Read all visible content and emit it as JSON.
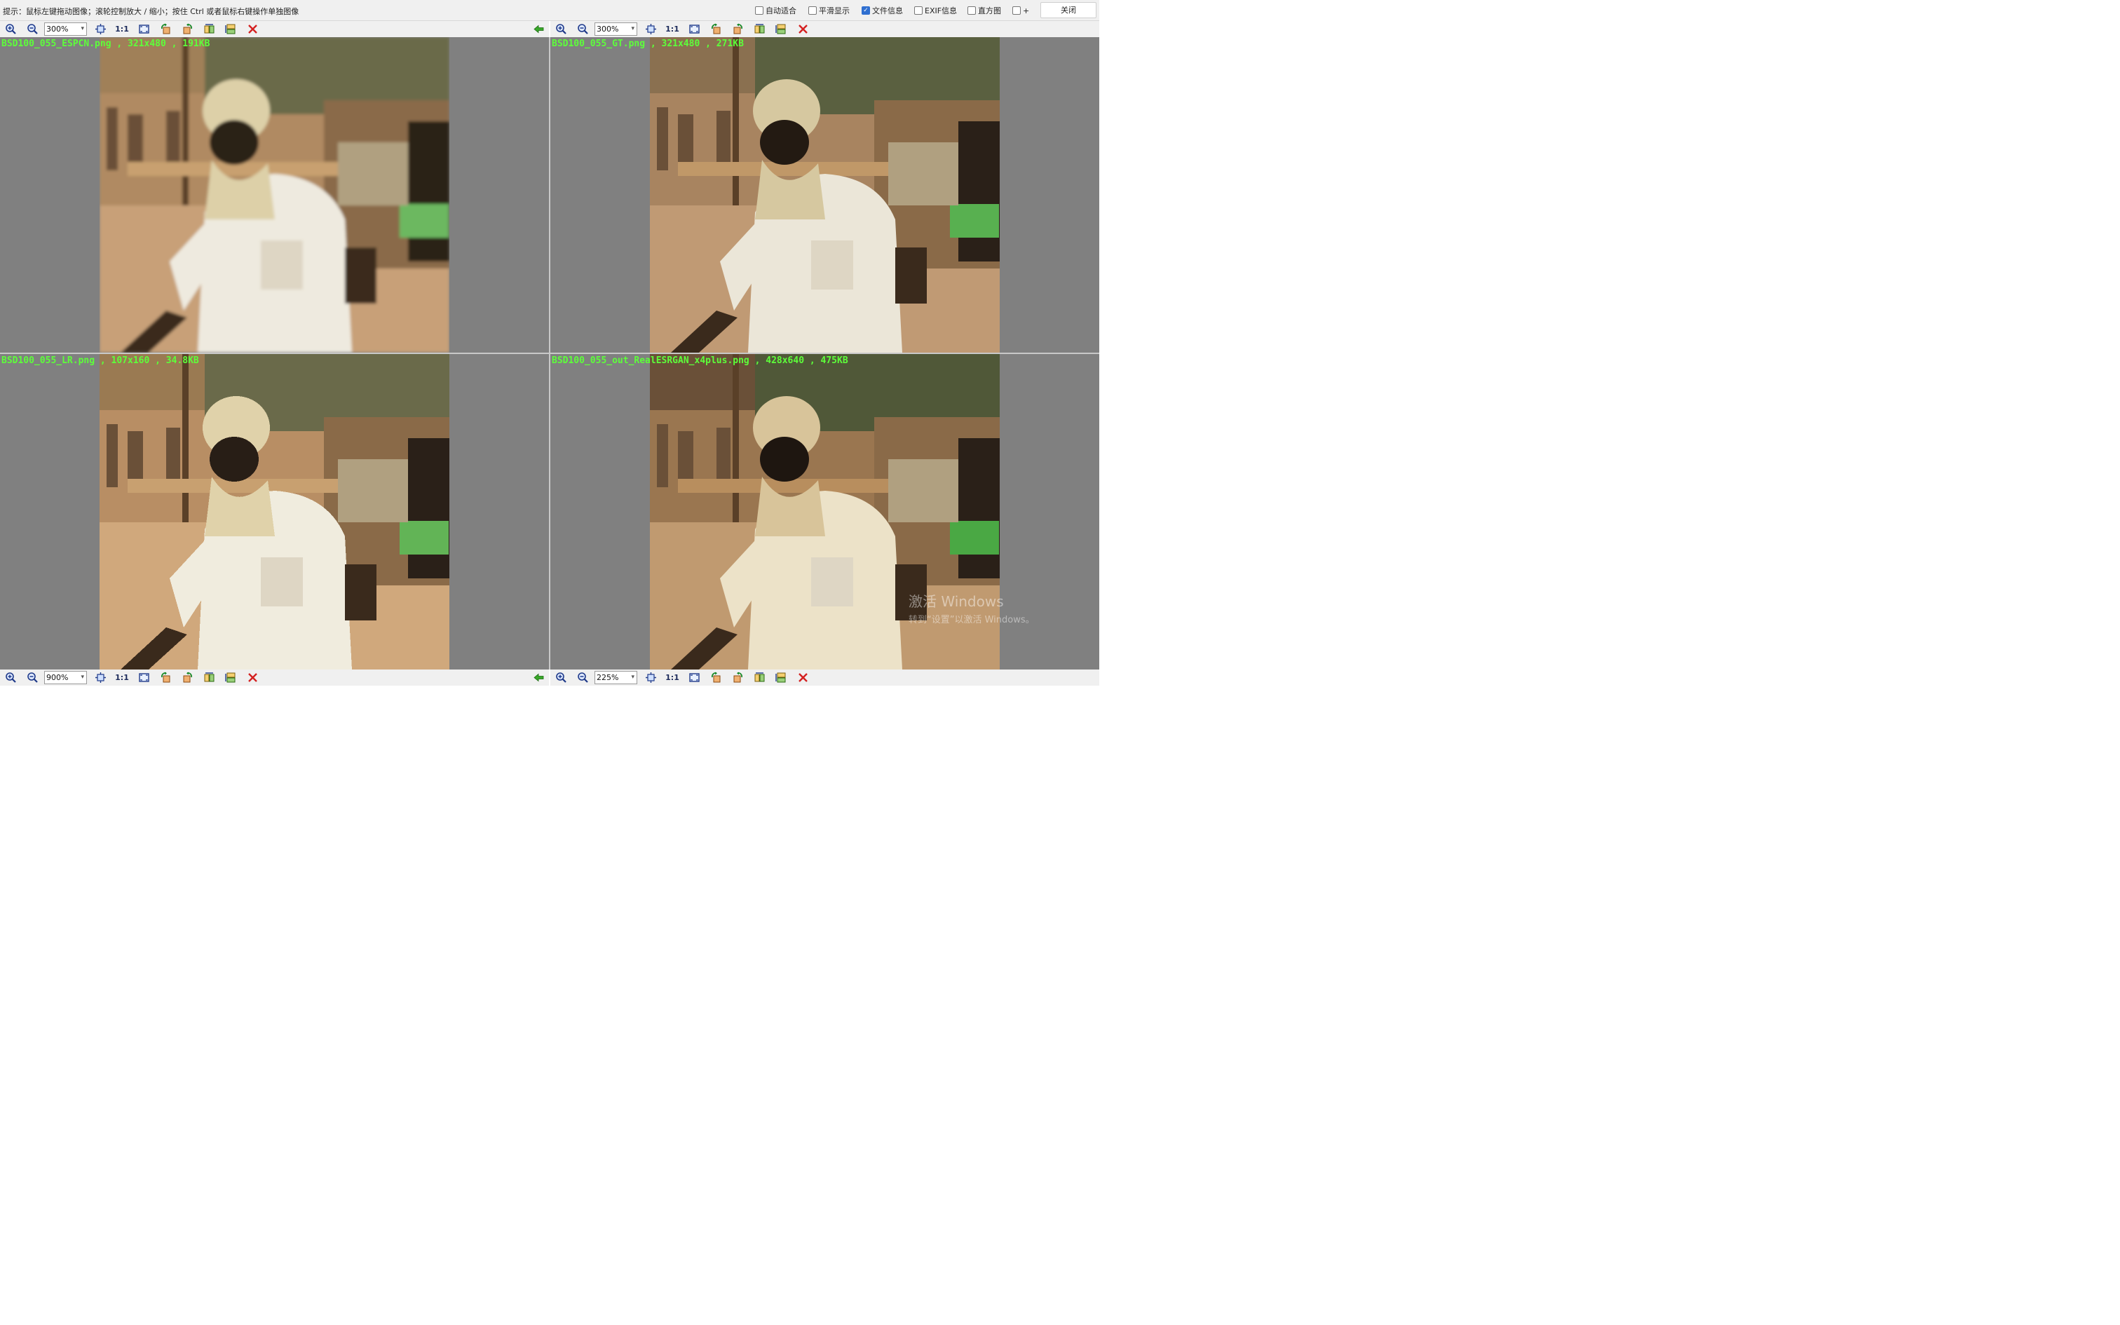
{
  "hintbar": {
    "hint": "提示：鼠标左键拖动图像；滚轮控制放大 / 缩小；按住 Ctrl 或者鼠标右键操作单独图像",
    "options": [
      {
        "label": "自动适合",
        "checked": false
      },
      {
        "label": "平滑显示",
        "checked": false
      },
      {
        "label": "文件信息",
        "checked": true
      },
      {
        "label": "EXIF信息",
        "checked": false
      },
      {
        "label": "直方图",
        "checked": false
      },
      {
        "label": "+",
        "checked": false
      }
    ],
    "close_label": "关闭"
  },
  "toolbar": {
    "one_to_one_label": "1:1"
  },
  "panes": [
    {
      "label": "BSD100_055_ESPCN.png , 321x480 , 191KB",
      "zoom": "300%",
      "style": "smooth-blur"
    },
    {
      "label": "BSD100_055_GT.png , 321x480 , 271KB",
      "zoom": "300%",
      "style": "sharp"
    },
    {
      "label": "BSD100_055_LR.png , 107x160 , 34.8KB",
      "zoom": "900%",
      "style": "pixelated"
    },
    {
      "label": "BSD100_055_out_RealESRGAN_x4plus.png , 428x640 , 475KB",
      "zoom": "225%",
      "style": "painted"
    }
  ],
  "watermark": {
    "title": "激活 Windows",
    "subtitle": "转到“设置”以激活 Windows。"
  },
  "colors": {
    "pane_bg": "#808080",
    "label_green": "#5dff3a",
    "toolbar_bg": "#f0f0f0"
  }
}
